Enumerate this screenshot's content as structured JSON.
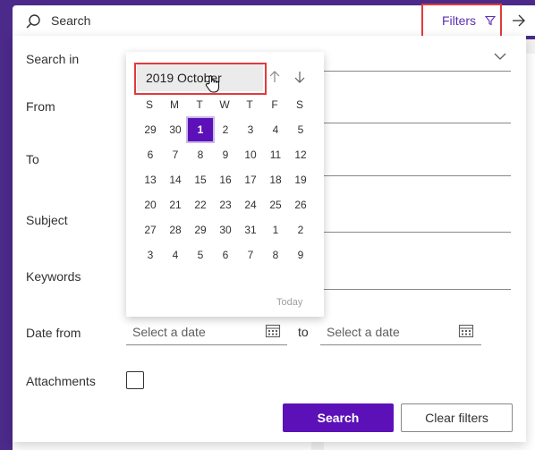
{
  "search": {
    "placeholder": "Search",
    "filters_label": "Filters"
  },
  "filters": {
    "search_in_label": "Search in",
    "from_label": "From",
    "to_label": "To",
    "subject_label": "Subject",
    "keywords_label": "Keywords",
    "date_from_label": "Date from",
    "date_to_word": "to",
    "date_from_placeholder": "Select a date",
    "date_to_placeholder": "Select a date",
    "attachments_label": "Attachments",
    "search_button": "Search",
    "clear_button": "Clear filters"
  },
  "datepicker": {
    "month_year": "2019 October",
    "weekdays": [
      "S",
      "M",
      "T",
      "W",
      "T",
      "F",
      "S"
    ],
    "weeks": [
      [
        "29",
        "30",
        "1",
        "2",
        "3",
        "4",
        "5"
      ],
      [
        "6",
        "7",
        "8",
        "9",
        "10",
        "11",
        "12"
      ],
      [
        "13",
        "14",
        "15",
        "16",
        "17",
        "18",
        "19"
      ],
      [
        "20",
        "21",
        "22",
        "23",
        "24",
        "25",
        "26"
      ],
      [
        "27",
        "28",
        "29",
        "30",
        "31",
        "1",
        "2"
      ],
      [
        "3",
        "4",
        "5",
        "6",
        "7",
        "8",
        "9"
      ]
    ],
    "selected_day": "1",
    "today_label": "Today"
  },
  "colors": {
    "accent": "#5c10b8",
    "highlight_box": "#e03b3b",
    "app_header": "#4b2a8a"
  }
}
